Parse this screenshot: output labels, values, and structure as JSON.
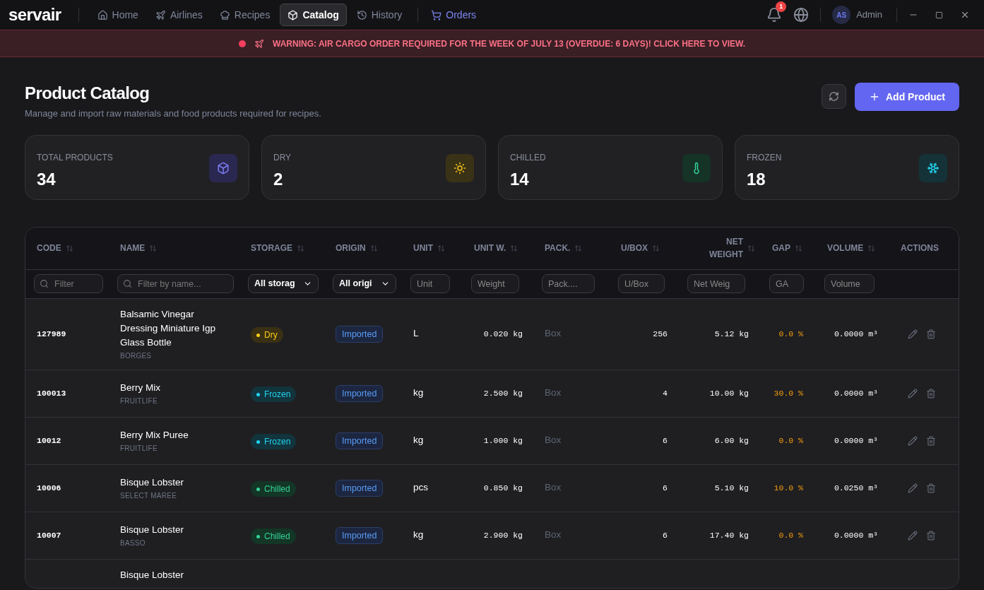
{
  "app": {
    "logo": "servair"
  },
  "nav": [
    {
      "label": "Home",
      "kind": "home",
      "selected": false
    },
    {
      "label": "Airlines",
      "kind": "plane",
      "selected": false
    },
    {
      "label": "Recipes",
      "kind": "chef",
      "selected": false
    },
    {
      "label": "Catalog",
      "kind": "box",
      "selected": true
    },
    {
      "label": "History",
      "kind": "history",
      "selected": false
    },
    {
      "label": "Orders",
      "kind": "cart",
      "selected": false
    }
  ],
  "notifications": {
    "count": "1"
  },
  "user": {
    "initials": "AS",
    "name": "Admin"
  },
  "banner": {
    "text": "WARNING: AIR CARGO ORDER REQUIRED FOR THE WEEK OF JULY 13 (OVERDUE: 6 DAYS)! CLICK HERE TO VIEW."
  },
  "page": {
    "title": "Product Catalog",
    "subtitle": "Manage and import raw materials and food products required for recipes.",
    "add_button": "Add Product"
  },
  "stats": [
    {
      "label": "TOTAL PRODUCTS",
      "value": "34",
      "kind": "total"
    },
    {
      "label": "DRY",
      "value": "2",
      "kind": "dry"
    },
    {
      "label": "CHILLED",
      "value": "14",
      "kind": "chilled"
    },
    {
      "label": "FROZEN",
      "value": "18",
      "kind": "frozen"
    }
  ],
  "table": {
    "columns": [
      {
        "label": "CODE",
        "sortable": true
      },
      {
        "label": "NAME",
        "sortable": true
      },
      {
        "label": "STORAGE",
        "sortable": true
      },
      {
        "label": "ORIGIN",
        "sortable": true
      },
      {
        "label": "UNIT",
        "sortable": true
      },
      {
        "label": "UNIT W.",
        "sortable": true
      },
      {
        "label": "PACK.",
        "sortable": true
      },
      {
        "label": "U/BOX",
        "sortable": true
      },
      {
        "label": "NET WEIGHT",
        "sortable": true
      },
      {
        "label": "GAP",
        "sortable": true
      },
      {
        "label": "VOLUME",
        "sortable": true
      },
      {
        "label": "ACTIONS",
        "sortable": false
      }
    ],
    "filters": [
      {
        "kind": "search",
        "placeholder": "Filter"
      },
      {
        "kind": "search",
        "placeholder": "Filter by name..."
      },
      {
        "kind": "select",
        "value": "All storag"
      },
      {
        "kind": "select",
        "value": "All origi"
      },
      {
        "kind": "text",
        "placeholder": "Unit"
      },
      {
        "kind": "text",
        "placeholder": "Weight"
      },
      {
        "kind": "text",
        "placeholder": "Pack...."
      },
      {
        "kind": "text",
        "placeholder": "U/Box"
      },
      {
        "kind": "text",
        "placeholder": "Net Weig"
      },
      {
        "kind": "text",
        "placeholder": "GA"
      },
      {
        "kind": "text",
        "placeholder": "Volume"
      }
    ],
    "rows": [
      {
        "code": "127989",
        "name": "Balsamic Vinegar Dressing Miniature Igp Glass Bottle",
        "brand": "BORGES",
        "storage": {
          "label": "Dry",
          "kind": "dry"
        },
        "origin": "Imported",
        "unit": "L",
        "unit_weight": "0.020 kg",
        "packaging": "Box",
        "units_per_box": "256",
        "net_weight": "5.12 kg",
        "gap": "0.0 %",
        "volume": "0.0000 m³"
      },
      {
        "code": "100013",
        "name": "Berry Mix",
        "brand": "FRUITLIFE",
        "storage": {
          "label": "Frozen",
          "kind": "frozen"
        },
        "origin": "Imported",
        "unit": "kg",
        "unit_weight": "2.500 kg",
        "packaging": "Box",
        "units_per_box": "4",
        "net_weight": "10.00 kg",
        "gap": "30.0 %",
        "volume": "0.0000 m³"
      },
      {
        "code": "10012",
        "name": "Berry Mix Puree",
        "brand": "FRUITLIFE",
        "storage": {
          "label": "Frozen",
          "kind": "frozen"
        },
        "origin": "Imported",
        "unit": "kg",
        "unit_weight": "1.000 kg",
        "packaging": "Box",
        "units_per_box": "6",
        "net_weight": "6.00 kg",
        "gap": "0.0 %",
        "volume": "0.0000 m³"
      },
      {
        "code": "10006",
        "name": "Bisque Lobster",
        "brand": "SELECT MAREE",
        "storage": {
          "label": "Chilled",
          "kind": "chilled"
        },
        "origin": "Imported",
        "unit": "pcs",
        "unit_weight": "0.850 kg",
        "packaging": "Box",
        "units_per_box": "6",
        "net_weight": "5.10 kg",
        "gap": "10.0 %",
        "volume": "0.0250 m³"
      },
      {
        "code": "10007",
        "name": "Bisque Lobster",
        "brand": "BASSO",
        "storage": {
          "label": "Chilled",
          "kind": "chilled"
        },
        "origin": "Imported",
        "unit": "kg",
        "unit_weight": "2.900 kg",
        "packaging": "Box",
        "units_per_box": "6",
        "net_weight": "17.40 kg",
        "gap": "0.0 %",
        "volume": "0.0000 m³"
      }
    ],
    "partial_row": {
      "name": "Bisque Lobster"
    }
  }
}
